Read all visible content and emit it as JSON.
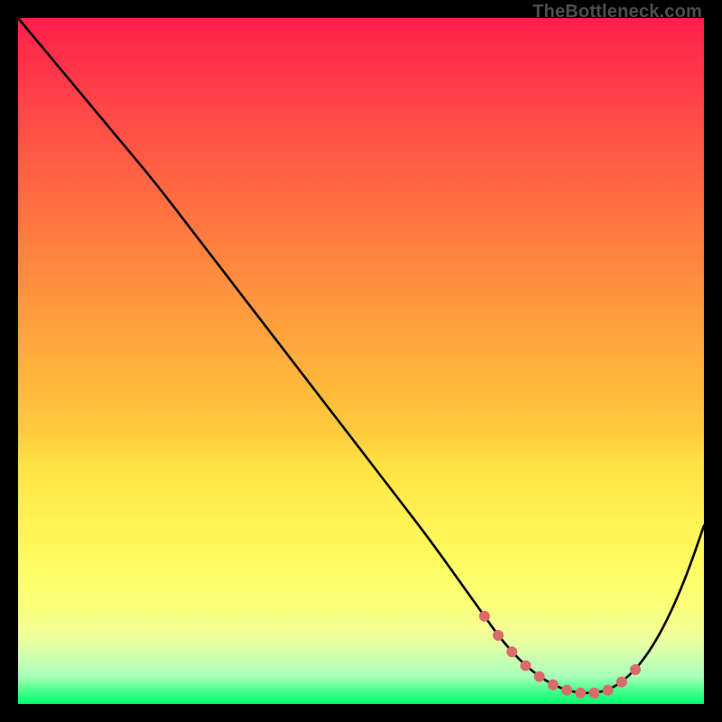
{
  "watermark": "TheBottleneck.com",
  "colors": {
    "background": "#000000",
    "curve": "#000000",
    "dots": "#d96b6b",
    "watermark": "#4d4d4d"
  },
  "chart_data": {
    "type": "line",
    "title": "",
    "xlabel": "",
    "ylabel": "",
    "xlim": [
      0,
      100
    ],
    "ylim": [
      0,
      100
    ],
    "grid": false,
    "legend": false,
    "series": [
      {
        "name": "bottleneck_curve",
        "x": [
          0,
          5,
          10,
          15,
          20,
          25,
          30,
          35,
          40,
          45,
          50,
          55,
          60,
          65,
          68,
          70,
          72,
          74,
          76,
          78,
          80,
          82,
          84,
          86,
          88,
          90,
          92,
          94,
          96,
          98,
          100
        ],
        "y": [
          100,
          94,
          88,
          82,
          76,
          69.5,
          63,
          56.5,
          50,
          43.5,
          37,
          30.5,
          24,
          17,
          12.8,
          10,
          7.6,
          5.6,
          4,
          2.8,
          2,
          1.6,
          1.6,
          2,
          3.2,
          5,
          7.6,
          11,
          15.2,
          20.2,
          26
        ]
      },
      {
        "name": "highlight_dots",
        "x": [
          68,
          70,
          72,
          74,
          76,
          78,
          80,
          82,
          84,
          86,
          88,
          90
        ],
        "y": [
          12.8,
          10,
          7.6,
          5.6,
          4.0,
          2.8,
          2.0,
          1.6,
          1.6,
          2.0,
          3.2,
          5.0
        ]
      }
    ]
  }
}
